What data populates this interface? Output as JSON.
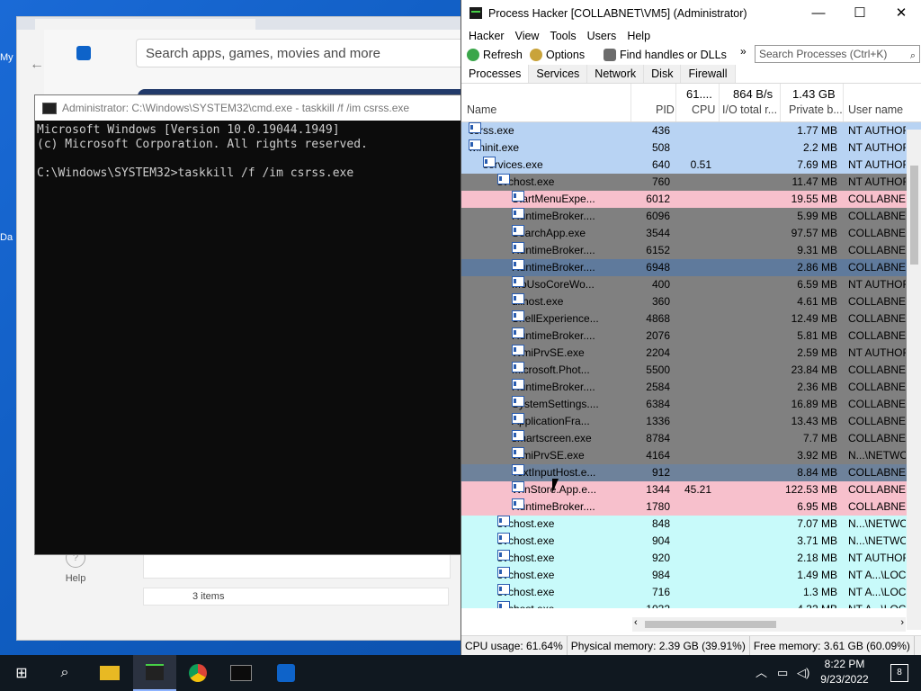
{
  "colors": {
    "blue_row": "#b8d3f3",
    "gray_row": "#808080",
    "pink_row": "#f7c0cc",
    "cyan_row": "#c8fafa",
    "selected_row": "#5f7a9c",
    "light_selected": "#6e829b"
  },
  "desktop": {
    "edge_label_1": "My",
    "edge_label_2": "Da"
  },
  "store": {
    "search_placeholder": "Search apps, games, movies and more",
    "help_label": "Help",
    "items_label": "3 items",
    "icons": {
      "back": "arrow-left-icon",
      "store": "store-icon",
      "help": "help-icon"
    }
  },
  "cmd": {
    "title": "Administrator: C:\\Windows\\SYSTEM32\\cmd.exe - taskkill  /f /im csrss.exe",
    "lines": [
      "Microsoft Windows [Version 10.0.19044.1949]",
      "(c) Microsoft Corporation. All rights reserved.",
      "",
      "C:\\Windows\\SYSTEM32>taskkill /f /im csrss.exe"
    ]
  },
  "ph": {
    "title": "Process Hacker [COLLABNET\\VM5] (Administrator)",
    "menu": [
      "Hacker",
      "View",
      "Tools",
      "Users",
      "Help"
    ],
    "toolbar": {
      "refresh": "Refresh",
      "options": "Options",
      "find": "Find handles or DLLs",
      "more": "»",
      "search_placeholder": "Search Processes (Ctrl+K)"
    },
    "tabs": [
      "Processes",
      "Services",
      "Network",
      "Disk",
      "Firewall"
    ],
    "columns": {
      "name": "Name",
      "pid": "PID",
      "cpu": "CPU",
      "io": "I/O total r...",
      "private": "Private b...",
      "user": "User name",
      "cpu_total": "61....",
      "io_total": "864 B/s",
      "private_total": "1.43 GB"
    },
    "rows": [
      {
        "name": "csrss.exe",
        "pid": "436",
        "cpu": "",
        "priv": "1.77 MB",
        "user": "NT AUTHOR",
        "indent": 0,
        "tw": "",
        "color": "blue_row"
      },
      {
        "name": "wininit.exe",
        "pid": "508",
        "cpu": "",
        "priv": "2.2 MB",
        "user": "NT AUTHOR",
        "indent": 0,
        "tw": "⌄",
        "color": "blue_row"
      },
      {
        "name": "services.exe",
        "pid": "640",
        "cpu": "0.51",
        "priv": "7.69 MB",
        "user": "NT AUTHOR",
        "indent": 1,
        "tw": "⌄",
        "color": "blue_row"
      },
      {
        "name": "svchost.exe",
        "pid": "760",
        "cpu": "",
        "priv": "11.47 MB",
        "user": "NT AUTHOR",
        "indent": 2,
        "tw": "⌄",
        "color": "gray_row"
      },
      {
        "name": "StartMenuExpe...",
        "pid": "6012",
        "cpu": "",
        "priv": "19.55 MB",
        "user": "COLLABNET",
        "indent": 3,
        "tw": "",
        "color": "pink_row"
      },
      {
        "name": "RuntimeBroker....",
        "pid": "6096",
        "cpu": "",
        "priv": "5.99 MB",
        "user": "COLLABNET",
        "indent": 3,
        "tw": "",
        "color": "gray_row"
      },
      {
        "name": "SearchApp.exe",
        "pid": "3544",
        "cpu": "",
        "priv": "97.57 MB",
        "user": "COLLABNET",
        "indent": 3,
        "tw": "",
        "color": "gray_row"
      },
      {
        "name": "RuntimeBroker....",
        "pid": "6152",
        "cpu": "",
        "priv": "9.31 MB",
        "user": "COLLABNET",
        "indent": 3,
        "tw": "",
        "color": "gray_row"
      },
      {
        "name": "RuntimeBroker....",
        "pid": "6948",
        "cpu": "",
        "priv": "2.86 MB",
        "user": "COLLABNET",
        "indent": 3,
        "tw": "",
        "color": "selected_row"
      },
      {
        "name": "MoUsoCoreWo...",
        "pid": "400",
        "cpu": "",
        "priv": "6.59 MB",
        "user": "NT AUTHOR",
        "indent": 3,
        "tw": "",
        "color": "gray_row"
      },
      {
        "name": "dllhost.exe",
        "pid": "360",
        "cpu": "",
        "priv": "4.61 MB",
        "user": "COLLABNET",
        "indent": 3,
        "tw": "",
        "color": "gray_row"
      },
      {
        "name": "ShellExperience...",
        "pid": "4868",
        "cpu": "",
        "priv": "12.49 MB",
        "user": "COLLABNET",
        "indent": 3,
        "tw": "",
        "color": "gray_row"
      },
      {
        "name": "RuntimeBroker....",
        "pid": "2076",
        "cpu": "",
        "priv": "5.81 MB",
        "user": "COLLABNET",
        "indent": 3,
        "tw": "",
        "color": "gray_row"
      },
      {
        "name": "WmiPrvSE.exe",
        "pid": "2204",
        "cpu": "",
        "priv": "2.59 MB",
        "user": "NT AUTHOR",
        "indent": 3,
        "tw": "",
        "color": "gray_row"
      },
      {
        "name": "Microsoft.Phot...",
        "pid": "5500",
        "cpu": "",
        "priv": "23.84 MB",
        "user": "COLLABNET",
        "indent": 3,
        "tw": "",
        "color": "gray_row"
      },
      {
        "name": "RuntimeBroker....",
        "pid": "2584",
        "cpu": "",
        "priv": "2.36 MB",
        "user": "COLLABNET",
        "indent": 3,
        "tw": "",
        "color": "gray_row"
      },
      {
        "name": "SystemSettings....",
        "pid": "6384",
        "cpu": "",
        "priv": "16.89 MB",
        "user": "COLLABNET",
        "indent": 3,
        "tw": "",
        "color": "gray_row"
      },
      {
        "name": "ApplicationFra...",
        "pid": "1336",
        "cpu": "",
        "priv": "13.43 MB",
        "user": "COLLABNET",
        "indent": 3,
        "tw": "",
        "color": "gray_row"
      },
      {
        "name": "smartscreen.exe",
        "pid": "8784",
        "cpu": "",
        "priv": "7.7 MB",
        "user": "COLLABNET",
        "indent": 3,
        "tw": "",
        "color": "gray_row"
      },
      {
        "name": "WmiPrvSE.exe",
        "pid": "4164",
        "cpu": "",
        "priv": "3.92 MB",
        "user": "N...\\NETWO",
        "indent": 3,
        "tw": "",
        "color": "gray_row"
      },
      {
        "name": "TextInputHost.e...",
        "pid": "912",
        "cpu": "",
        "priv": "8.84 MB",
        "user": "COLLABNET",
        "indent": 3,
        "tw": "",
        "color": "light_selected"
      },
      {
        "name": "WinStore.App.e...",
        "pid": "1344",
        "cpu": "45.21",
        "priv": "122.53 MB",
        "user": "COLLABNET",
        "indent": 3,
        "tw": "",
        "color": "pink_row"
      },
      {
        "name": "RuntimeBroker....",
        "pid": "1780",
        "cpu": "",
        "priv": "6.95 MB",
        "user": "COLLABNET",
        "indent": 3,
        "tw": "",
        "color": "pink_row"
      },
      {
        "name": "svchost.exe",
        "pid": "848",
        "cpu": "",
        "priv": "7.07 MB",
        "user": "N...\\NETWO",
        "indent": 2,
        "tw": "",
        "color": "cyan_row"
      },
      {
        "name": "svchost.exe",
        "pid": "904",
        "cpu": "",
        "priv": "3.71 MB",
        "user": "N...\\NETWO",
        "indent": 2,
        "tw": "",
        "color": "cyan_row"
      },
      {
        "name": "svchost.exe",
        "pid": "920",
        "cpu": "",
        "priv": "2.18 MB",
        "user": "NT AUTHOR",
        "indent": 2,
        "tw": "",
        "color": "cyan_row"
      },
      {
        "name": "svchost.exe",
        "pid": "984",
        "cpu": "",
        "priv": "1.49 MB",
        "user": "NT A...\\LOC",
        "indent": 2,
        "tw": "",
        "color": "cyan_row"
      },
      {
        "name": "svchost.exe",
        "pid": "716",
        "cpu": "",
        "priv": "1.3 MB",
        "user": "NT A...\\LOC",
        "indent": 2,
        "tw": "",
        "color": "cyan_row"
      },
      {
        "name": "svchost.exe",
        "pid": "1032",
        "cpu": "",
        "priv": "4.32 MB",
        "user": "NT A...\\LOC",
        "indent": 2,
        "tw": "",
        "color": "cyan_row"
      },
      {
        "name": "svchost.exe",
        "pid": "",
        "cpu": "",
        "priv": "",
        "user": "",
        "indent": 2,
        "tw": "",
        "color": "cyan_row"
      }
    ],
    "status": {
      "cpu": "CPU usage: 61.64%",
      "physical": "Physical memory: 2.39 GB (39.91%)",
      "free": "Free memory: 3.61 GB (60.09%)"
    }
  },
  "taskbar": {
    "time": "8:22 PM",
    "date": "9/23/2022",
    "notifications": "8",
    "icons": [
      "windows-start-icon",
      "search-icon",
      "file-explorer-icon",
      "process-hacker-icon",
      "chrome-icon",
      "cmd-icon",
      "store-icon"
    ]
  }
}
